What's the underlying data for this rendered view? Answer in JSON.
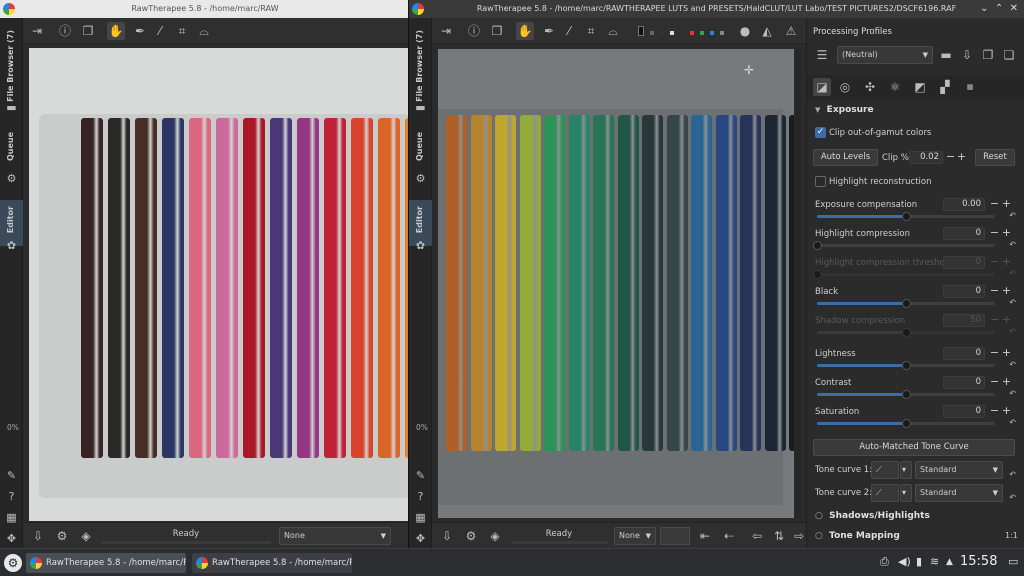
{
  "left_window": {
    "title": "RawTherapee 5.8 - /home/marc/RAW",
    "vtabs": [
      "File Browser (7)",
      "Queue",
      "Editor"
    ],
    "zoom_percent": "0%",
    "status_text": "Ready",
    "profile_combo": "None"
  },
  "right_window": {
    "title": "RawTherapee 5.8 - /home/marc/RAWTHERAPEE LUTS and PRESETS/HaldCLUT/LUT Labo/TEST PICTURES2/DSCF6196.RAF",
    "vtabs": [
      "File Browser (7)",
      "Queue",
      "Editor"
    ],
    "zoom_percent": "0%",
    "status_text": "Ready",
    "profile_combo": "None"
  },
  "panel": {
    "processing_profiles_label": "Processing Profiles",
    "profile_value": "(Neutral)",
    "exposure_header": "Exposure",
    "clip_gamut_label": "Clip out-of-gamut colors",
    "clip_gamut_checked": true,
    "auto_levels_label": "Auto Levels",
    "clip_percent_label": "Clip %",
    "clip_percent_value": "0.02",
    "reset_label": "Reset",
    "highlight_reconstruction_label": "Highlight reconstruction",
    "sliders": [
      {
        "label": "Exposure compensation",
        "value": "0.00",
        "pos": 0.5,
        "enabled": true
      },
      {
        "label": "Highlight compression",
        "value": "0",
        "pos": 0.0,
        "enabled": true
      },
      {
        "label": "Highlight compression threshold",
        "value": "0",
        "pos": 0.0,
        "enabled": false
      },
      {
        "label": "Black",
        "value": "0",
        "pos": 0.5,
        "enabled": true
      },
      {
        "label": "Shadow compression",
        "value": "50",
        "pos": 0.5,
        "enabled": false
      },
      {
        "label": "Lightness",
        "value": "0",
        "pos": 0.5,
        "enabled": true
      },
      {
        "label": "Contrast",
        "value": "0",
        "pos": 0.5,
        "enabled": true
      },
      {
        "label": "Saturation",
        "value": "0",
        "pos": 0.5,
        "enabled": true
      }
    ],
    "auto_tone_curve_label": "Auto-Matched Tone Curve",
    "tone_curve_1_label": "Tone curve 1:",
    "tone_curve_1_value": "Standard",
    "tone_curve_2_label": "Tone curve 2:",
    "tone_curve_2_value": "Standard",
    "shadows_highlights_label": "Shadows/Highlights",
    "tone_mapping_label": "Tone Mapping",
    "tone_mapping_badge": "1:1"
  },
  "taskbar": {
    "tasks": [
      "RawTherapee 5.8 - /home/marc/R...",
      "RawTherapee 5.8 - /home/marc/R..."
    ],
    "clock": "15:58"
  },
  "colors": {
    "accent": "#3a6ea5",
    "left_pens": [
      "#3a2526",
      "#2b2a28",
      "#4a2f27",
      "#2f3a6a",
      "#e56e86",
      "#d66fa4",
      "#b3192a",
      "#4d3a7e",
      "#9c3a8c",
      "#c9243a",
      "#e2472f",
      "#e56a2a",
      "#f08a28"
    ],
    "right_pens": [
      "#b8642a",
      "#c28a30",
      "#c8b030",
      "#9cb43a",
      "#2e9a5a",
      "#2a8a6c",
      "#2a7a5a",
      "#245a4a",
      "#2a3a3a",
      "#3a4a4e",
      "#2a6a9a",
      "#2a4c8a",
      "#2a3660",
      "#1f2838",
      "#1a1c22"
    ]
  }
}
